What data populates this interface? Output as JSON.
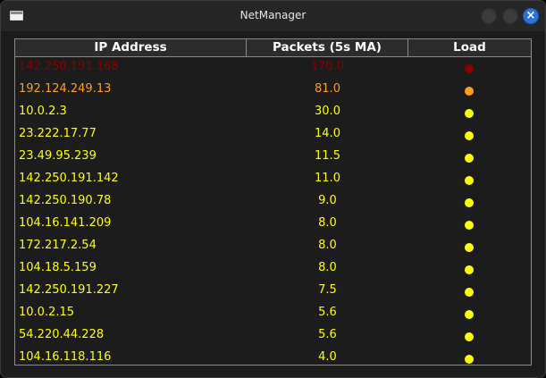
{
  "window": {
    "title": "NetManager"
  },
  "table": {
    "headers": [
      "IP Address",
      "Packets (5s MA)",
      "Load"
    ],
    "rows": [
      {
        "ip": "142.250.191.168",
        "packets": "170.0",
        "color": "#8b0000"
      },
      {
        "ip": "192.124.249.13",
        "packets": "81.0",
        "color": "#ff9f1a"
      },
      {
        "ip": "10.0.2.3",
        "packets": "30.0",
        "color": "#ffff00"
      },
      {
        "ip": "23.222.17.77",
        "packets": "14.0",
        "color": "#ffff00"
      },
      {
        "ip": "23.49.95.239",
        "packets": "11.5",
        "color": "#ffff00"
      },
      {
        "ip": "142.250.191.142",
        "packets": "11.0",
        "color": "#ffff00"
      },
      {
        "ip": "142.250.190.78",
        "packets": "9.0",
        "color": "#ffff00"
      },
      {
        "ip": "104.16.141.209",
        "packets": "8.0",
        "color": "#ffff00"
      },
      {
        "ip": "172.217.2.54",
        "packets": "8.0",
        "color": "#ffff00"
      },
      {
        "ip": "104.18.5.159",
        "packets": "8.0",
        "color": "#ffff00"
      },
      {
        "ip": "142.250.191.227",
        "packets": "7.5",
        "color": "#ffff00"
      },
      {
        "ip": "10.0.2.15",
        "packets": "5.6",
        "color": "#ffff00"
      },
      {
        "ip": "54.220.44.228",
        "packets": "5.6",
        "color": "#ffff00"
      },
      {
        "ip": "104.16.118.116",
        "packets": "4.0",
        "color": "#ffff00"
      }
    ]
  }
}
